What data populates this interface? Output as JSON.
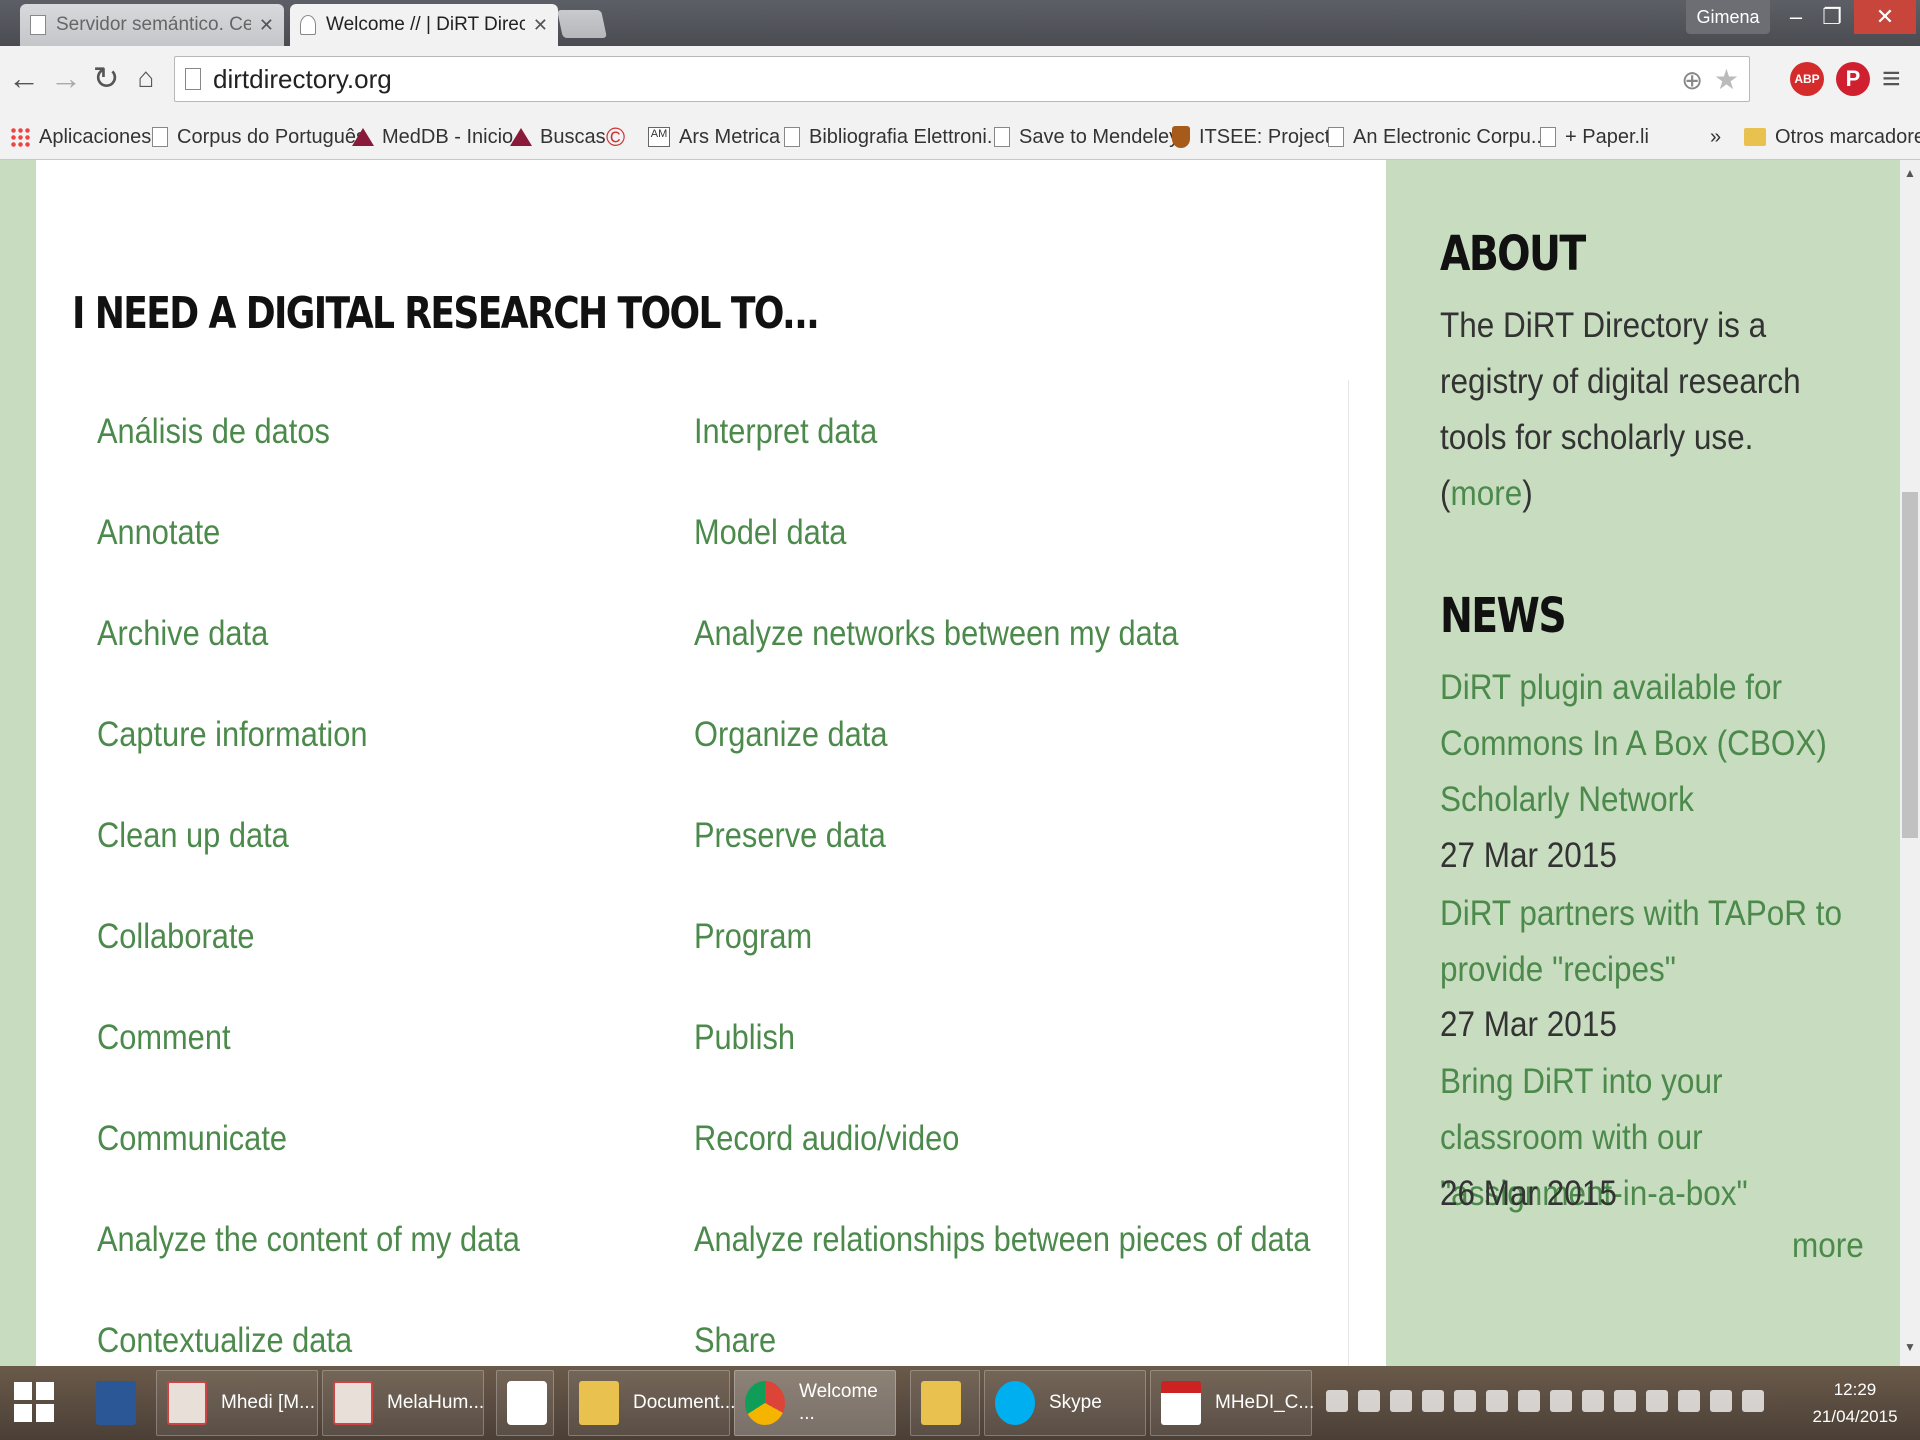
{
  "browser": {
    "tabs": [
      {
        "title": "Servidor semántico. Centr",
        "active": false
      },
      {
        "title": "Welcome // | DiRT Directo",
        "active": true
      }
    ],
    "profile": "Gimena",
    "url": "dirtdirectory.org",
    "bookmarks": [
      "Aplicaciones",
      "Corpus do Português",
      "MedDB - Inicio",
      "Buscas",
      "Ars Metrica",
      "Bibliografia Elettroni...",
      "Save to Mendeley",
      "ITSEE: Projects",
      "An Electronic Corpu...",
      "+ Paper.li",
      "»",
      "Otros marcadores"
    ]
  },
  "main": {
    "heading": "I NEED A DIGITAL RESEARCH TOOL TO...",
    "left_links": [
      "Análisis de datos",
      "Annotate",
      "Archive data",
      "Capture information",
      "Clean up data",
      "Collaborate",
      "Comment",
      "Communicate",
      "Analyze the content of my data",
      "Contextualize data"
    ],
    "right_links": [
      "Interpret data",
      "Model data",
      "Analyze networks between my data",
      "Organize data",
      "Preserve data",
      "Program",
      "Publish",
      "Record audio/video",
      "Analyze relationships between pieces of data",
      "Share"
    ]
  },
  "sidebar": {
    "about_heading": "ABOUT",
    "about_text": "The DiRT Directory is a registry of digital research tools for scholarly use. (",
    "about_more": "more",
    "about_close": ")",
    "news_heading": "NEWS",
    "news": [
      {
        "title": "DiRT plugin available for Commons In A Box (CBOX) Scholarly Network",
        "date": "27 Mar 2015"
      },
      {
        "title": "DiRT partners with TAPoR to provide \"recipes\"",
        "date": "27 Mar 2015"
      },
      {
        "title": "Bring DiRT into your classroom with our \"assignment-in-a-box\"",
        "date": "26 Mar 2015"
      }
    ],
    "news_more": "more"
  },
  "taskbar": {
    "tasks": [
      "Mhedi [M...",
      "MelaHum...",
      "Document...",
      "Welcome ...",
      "Skype",
      "MHeDI_C..."
    ],
    "time": "12:29",
    "date": "21/04/2015"
  },
  "colors": {
    "link": "#4c8a4c",
    "sidebar_bg": "#c8dcc0",
    "heading": "#111111"
  }
}
